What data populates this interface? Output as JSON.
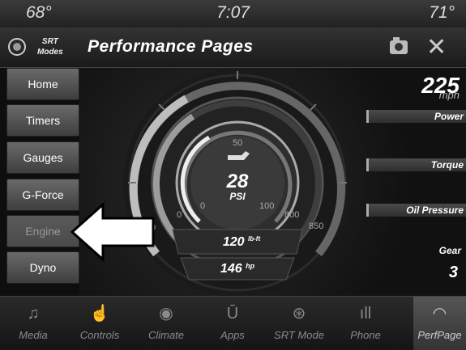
{
  "status": {
    "temp_left": "68°",
    "time": "7:07",
    "temp_right": "71°"
  },
  "header": {
    "srt_logo_top": "SRT",
    "srt_logo_bottom": "Modes",
    "title": "Performance Pages"
  },
  "sidebar": {
    "items": [
      {
        "label": "Home",
        "state": "enabled"
      },
      {
        "label": "Timers",
        "state": "enabled"
      },
      {
        "label": "Gauges",
        "state": "enabled"
      },
      {
        "label": "G-Force",
        "state": "enabled"
      },
      {
        "label": "Engine",
        "state": "disabled"
      },
      {
        "label": "Dyno",
        "state": "enabled"
      }
    ]
  },
  "gauge": {
    "boost_value": "28",
    "boost_unit": "PSI",
    "inner_scale": [
      "0",
      "50",
      "100"
    ],
    "outer_scale": [
      "0",
      "800",
      "850"
    ],
    "torque_value": "120",
    "torque_unit": "lb-ft",
    "hp_value": "146",
    "hp_unit": "hp"
  },
  "speed": {
    "value": "225",
    "unit": "mph"
  },
  "metrics": [
    {
      "label": "Power"
    },
    {
      "label": "Torque"
    },
    {
      "label": "Oil Pressure"
    }
  ],
  "gear": {
    "label": "Gear",
    "value": "3"
  },
  "nav": {
    "items": [
      {
        "label": "Media",
        "icon": "music-note-icon",
        "glyph": "♫"
      },
      {
        "label": "Controls",
        "icon": "hand-touch-icon",
        "glyph": "☝"
      },
      {
        "label": "Climate",
        "icon": "climate-icon",
        "glyph": "◉"
      },
      {
        "label": "Apps",
        "icon": "apps-icon",
        "glyph": "Ū"
      },
      {
        "label": "SRT Mode",
        "icon": "steering-wheel-icon",
        "glyph": "⊛"
      },
      {
        "label": "Phone",
        "icon": "phone-signal-icon",
        "glyph": "ıll"
      },
      {
        "label": "PerfPage",
        "icon": "gauge-icon",
        "glyph": "◠"
      }
    ],
    "active": "PerfPage"
  }
}
